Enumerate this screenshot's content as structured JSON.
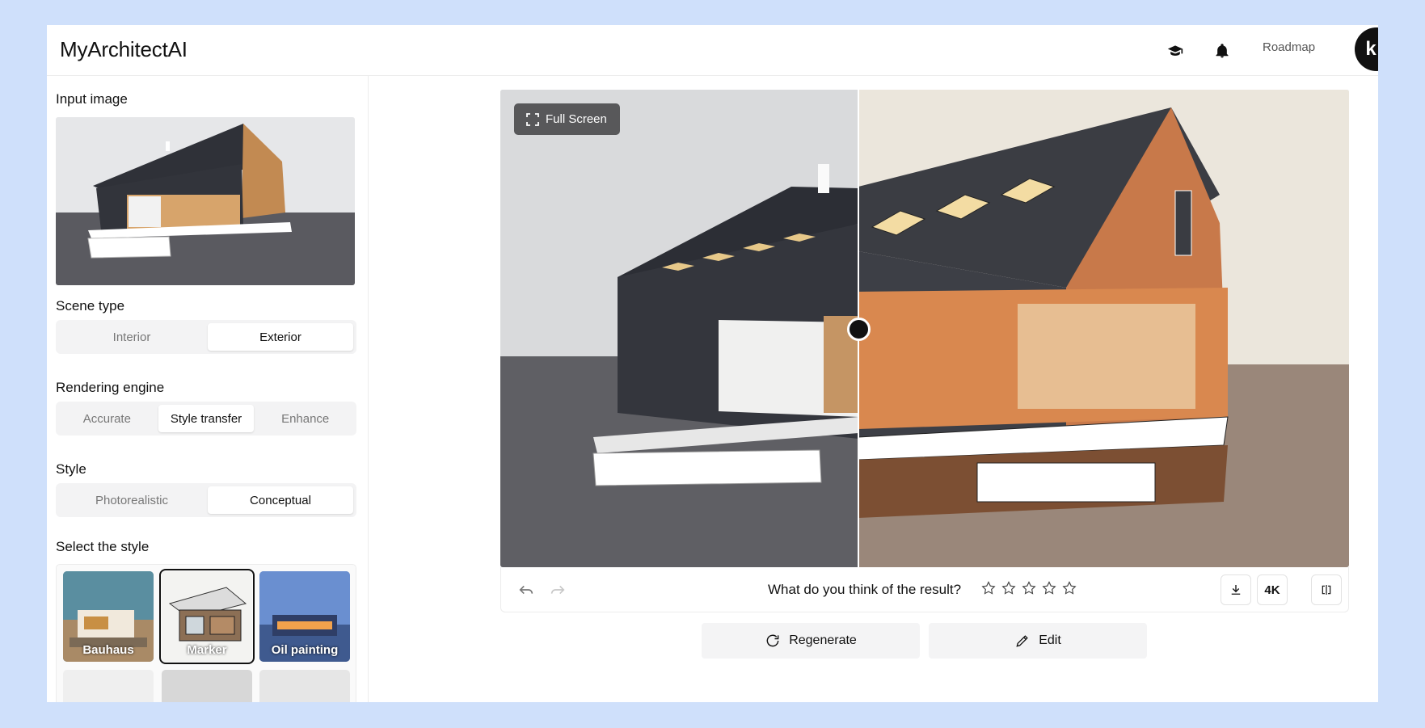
{
  "app": {
    "title": "MyArchitectAI"
  },
  "header": {
    "learn_icon": "graduation-cap-icon",
    "notifications_icon": "bell-icon",
    "roadmap_label": "Roadmap",
    "avatar_initial": "k"
  },
  "sidebar": {
    "input_image_label": "Input image",
    "scene_type": {
      "label": "Scene type",
      "options": [
        "Interior",
        "Exterior"
      ],
      "selected": "Exterior"
    },
    "rendering_engine": {
      "label": "Rendering engine",
      "options": [
        "Accurate",
        "Style transfer",
        "Enhance"
      ],
      "selected": "Style transfer"
    },
    "style": {
      "label": "Style",
      "options": [
        "Photorealistic",
        "Conceptual"
      ],
      "selected": "Conceptual"
    },
    "select_style": {
      "label": "Select the style",
      "cards": [
        "Bauhaus",
        "Marker",
        "Oil painting"
      ],
      "selected": "Marker"
    }
  },
  "viewer": {
    "fullscreen_label": "Full Screen",
    "compare_position": 0.42
  },
  "feedback": {
    "question": "What do you think of the result?",
    "stars_total": 5,
    "stars_filled": 0,
    "resolution_label": "4K"
  },
  "actions": {
    "regenerate_label": "Regenerate",
    "edit_label": "Edit"
  },
  "colors": {
    "background": "#cfe0fb",
    "accent": "#111111",
    "segment_bg": "#f3f3f4"
  }
}
